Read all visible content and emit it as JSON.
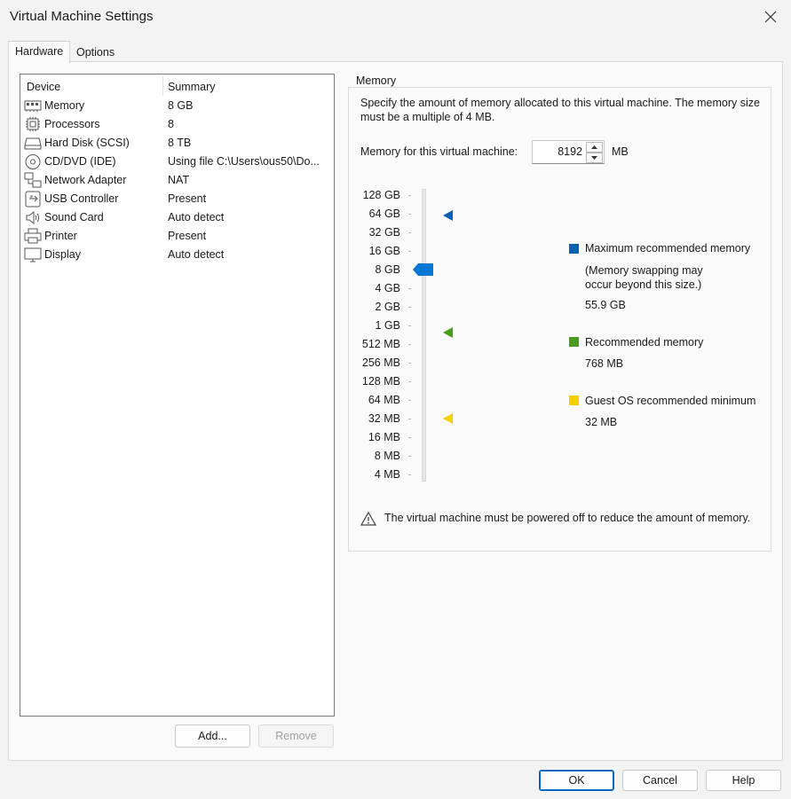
{
  "window": {
    "title": "Virtual Machine Settings"
  },
  "tabs": [
    {
      "label": "Hardware",
      "selected": true
    },
    {
      "label": "Options",
      "selected": false
    }
  ],
  "device_list": {
    "columns": [
      "Device",
      "Summary"
    ],
    "rows": [
      {
        "icon": "memory-icon",
        "device": "Memory",
        "summary": "8 GB"
      },
      {
        "icon": "processor-icon",
        "device": "Processors",
        "summary": "8"
      },
      {
        "icon": "hard-disk-icon",
        "device": "Hard Disk (SCSI)",
        "summary": "8 TB"
      },
      {
        "icon": "cd-dvd-icon",
        "device": "CD/DVD (IDE)",
        "summary": "Using file C:\\Users\\ous50\\Do..."
      },
      {
        "icon": "network-adapter-icon",
        "device": "Network Adapter",
        "summary": "NAT"
      },
      {
        "icon": "usb-icon",
        "device": "USB Controller",
        "summary": "Present"
      },
      {
        "icon": "sound-icon",
        "device": "Sound Card",
        "summary": "Auto detect"
      },
      {
        "icon": "printer-icon",
        "device": "Printer",
        "summary": "Present"
      },
      {
        "icon": "display-icon",
        "device": "Display",
        "summary": "Auto detect"
      }
    ],
    "add_label": "Add...",
    "remove_label": "Remove"
  },
  "memory": {
    "group_label": "Memory",
    "description": "Specify the amount of memory allocated to this virtual machine. The memory size must be a multiple of 4 MB.",
    "field_label": "Memory for this virtual machine:",
    "value": "8192",
    "unit": "MB",
    "scale": [
      "128 GB",
      "64 GB",
      "32 GB",
      "16 GB",
      "8 GB",
      "4 GB",
      "2 GB",
      "1 GB",
      "512 MB",
      "256 MB",
      "128 MB",
      "64 MB",
      "32 MB",
      "16 MB",
      "8 MB",
      "4 MB"
    ],
    "slider_selected": "8 GB",
    "legend": {
      "max_title": "Maximum recommended memory",
      "max_note": "(Memory swapping may occur beyond this size.)",
      "max_value": "55.9 GB",
      "rec_title": "Recommended memory",
      "rec_value": "768 MB",
      "min_title": "Guest OS recommended minimum",
      "min_value": "32 MB"
    },
    "warning": "The virtual machine must be powered off to reduce the amount of memory.",
    "colors": {
      "max": "#0a5fb0",
      "recommended": "#4a9a1e",
      "minimum": "#f5d000",
      "slider_thumb": "#0078d4"
    }
  },
  "footer": {
    "ok_label": "OK",
    "cancel_label": "Cancel",
    "help_label": "Help"
  }
}
